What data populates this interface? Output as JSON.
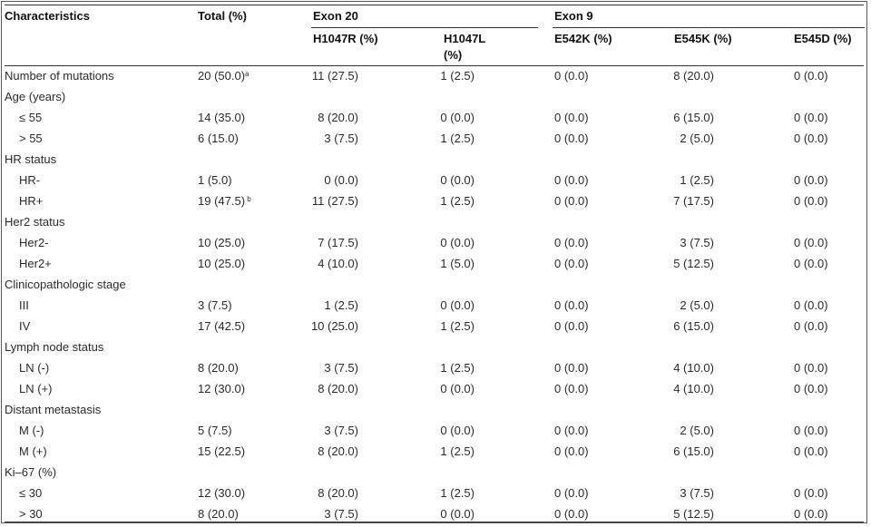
{
  "table": {
    "header": {
      "characteristics": "Characteristics",
      "total": "Total (%)",
      "exon20": "Exon 20",
      "exon9": "Exon 9",
      "h1047r": "H1047R (%)",
      "h1047l_line1": "H1047L",
      "h1047l_line2": "(%)",
      "e542k": "E542K (%)",
      "e545k": "E545K (%)",
      "e545d": "E545D (%)"
    },
    "rows": [
      {
        "label": "Number of mutations",
        "indent": false,
        "total": "20 (50.0)",
        "sup": "a",
        "h1047r": "11 (27.5)",
        "h1047l": "1 (2.5)",
        "e542k": "0 (0.0)",
        "e545k": "8 (20.0)",
        "e545d": "0 (0.0)"
      },
      {
        "label": "Age (years)",
        "indent": false,
        "total": "",
        "sup": "",
        "h1047r": "",
        "h1047l": "",
        "e542k": "",
        "e545k": "",
        "e545d": ""
      },
      {
        "label": "≤ 55",
        "indent": true,
        "total": "14 (35.0)",
        "sup": "",
        "h1047r": "8 (20.0)",
        "h1047l": "0 (0.0)",
        "e542k": "0 (0.0)",
        "e545k": "6 (15.0)",
        "e545d": "0 (0.0)"
      },
      {
        "label": "> 55",
        "indent": true,
        "total": "6 (15.0)",
        "sup": "",
        "h1047r": "3 (7.5)",
        "h1047l": "1 (2.5)",
        "e542k": "0 (0.0)",
        "e545k": "2 (5.0)",
        "e545d": "0 (0.0)"
      },
      {
        "label": "HR status",
        "indent": false,
        "total": "",
        "sup": "",
        "h1047r": "",
        "h1047l": "",
        "e542k": "",
        "e545k": "",
        "e545d": ""
      },
      {
        "label": "HR-",
        "indent": true,
        "total": "1 (5.0)",
        "sup": "",
        "h1047r": "0 (0.0)",
        "h1047l": "0 (0.0)",
        "e542k": "0 (0.0)",
        "e545k": "1 (2.5)",
        "e545d": "0 (0.0)"
      },
      {
        "label": "HR+",
        "indent": true,
        "total": "19 (47.5)",
        "sup": "b",
        "h1047r": "11 (27.5)",
        "h1047l": "1 (2.5)",
        "e542k": "0 (0.0)",
        "e545k": "7 (17.5)",
        "e545d": "0 (0.0)"
      },
      {
        "label": "Her2 status",
        "indent": false,
        "total": "",
        "sup": "",
        "h1047r": "",
        "h1047l": "",
        "e542k": "",
        "e545k": "",
        "e545d": ""
      },
      {
        "label": "Her2-",
        "indent": true,
        "total": "10 (25.0)",
        "sup": "",
        "h1047r": "7 (17.5)",
        "h1047l": "0 (0.0)",
        "e542k": "0 (0.0)",
        "e545k": "3 (7.5)",
        "e545d": "0 (0.0)"
      },
      {
        "label": "Her2+",
        "indent": true,
        "total": "10 (25.0)",
        "sup": "",
        "h1047r": "4 (10.0)",
        "h1047l": "1 (5.0)",
        "e542k": "0 (0.0)",
        "e545k": "5 (12.5)",
        "e545d": "0 (0.0)"
      },
      {
        "label": "Clinicopathologic stage",
        "indent": false,
        "total": "",
        "sup": "",
        "h1047r": "",
        "h1047l": "",
        "e542k": "",
        "e545k": "",
        "e545d": ""
      },
      {
        "label": "III",
        "indent": true,
        "total": "3 (7.5)",
        "sup": "",
        "h1047r": "1 (2.5)",
        "h1047l": "0 (0.0)",
        "e542k": "0 (0.0)",
        "e545k": "2 (5.0)",
        "e545d": "0 (0.0)"
      },
      {
        "label": "IV",
        "indent": true,
        "total": "17 (42.5)",
        "sup": "",
        "h1047r": "10 (25.0)",
        "h1047l": "1 (2.5)",
        "e542k": "0 (0.0)",
        "e545k": "6 (15.0)",
        "e545d": "0 (0.0)"
      },
      {
        "label": "Lymph node status",
        "indent": false,
        "total": "",
        "sup": "",
        "h1047r": "",
        "h1047l": "",
        "e542k": "",
        "e545k": "",
        "e545d": ""
      },
      {
        "label": "LN (-)",
        "indent": true,
        "total": "8 (20.0)",
        "sup": "",
        "h1047r": "3 (7.5)",
        "h1047l": "1 (2.5)",
        "e542k": "0 (0.0)",
        "e545k": "4 (10.0)",
        "e545d": "0 (0.0)"
      },
      {
        "label": "LN (+)",
        "indent": true,
        "total": "12 (30.0)",
        "sup": "",
        "h1047r": "8 (20.0)",
        "h1047l": "0 (0.0)",
        "e542k": "0 (0.0)",
        "e545k": "4 (10.0)",
        "e545d": "0 (0.0)"
      },
      {
        "label": "Distant metastasis",
        "indent": false,
        "total": "",
        "sup": "",
        "h1047r": "",
        "h1047l": "",
        "e542k": "",
        "e545k": "",
        "e545d": ""
      },
      {
        "label": "M (-)",
        "indent": true,
        "total": "5 (7.5)",
        "sup": "",
        "h1047r": "3 (7.5)",
        "h1047l": "0 (0.0)",
        "e542k": "0 (0.0)",
        "e545k": "2 (5.0)",
        "e545d": "0 (0.0)"
      },
      {
        "label": "M (+)",
        "indent": true,
        "total": "15 (22.5)",
        "sup": "",
        "h1047r": "8 (20.0)",
        "h1047l": "1 (2.5)",
        "e542k": "0 (0.0)",
        "e545k": "6 (15.0)",
        "e545d": "0 (0.0)"
      },
      {
        "label": "Ki–67 (%)",
        "indent": false,
        "total": "",
        "sup": "",
        "h1047r": "",
        "h1047l": "",
        "e542k": "",
        "e545k": "",
        "e545d": ""
      },
      {
        "label": "≤ 30",
        "indent": true,
        "total": "12 (30.0)",
        "sup": "",
        "h1047r": "8 (20.0)",
        "h1047l": "1 (2.5)",
        "e542k": "0 (0.0)",
        "e545k": "3 (7.5)",
        "e545d": "0 (0.0)"
      },
      {
        "label": "> 30",
        "indent": true,
        "total": "8 (20.0)",
        "sup": "",
        "h1047r": "3 (7.5)",
        "h1047l": "0 (0.0)",
        "e542k": "0 (0.0)",
        "e545k": "5 (12.5)",
        "e545d": "0 (0.0)"
      }
    ]
  }
}
